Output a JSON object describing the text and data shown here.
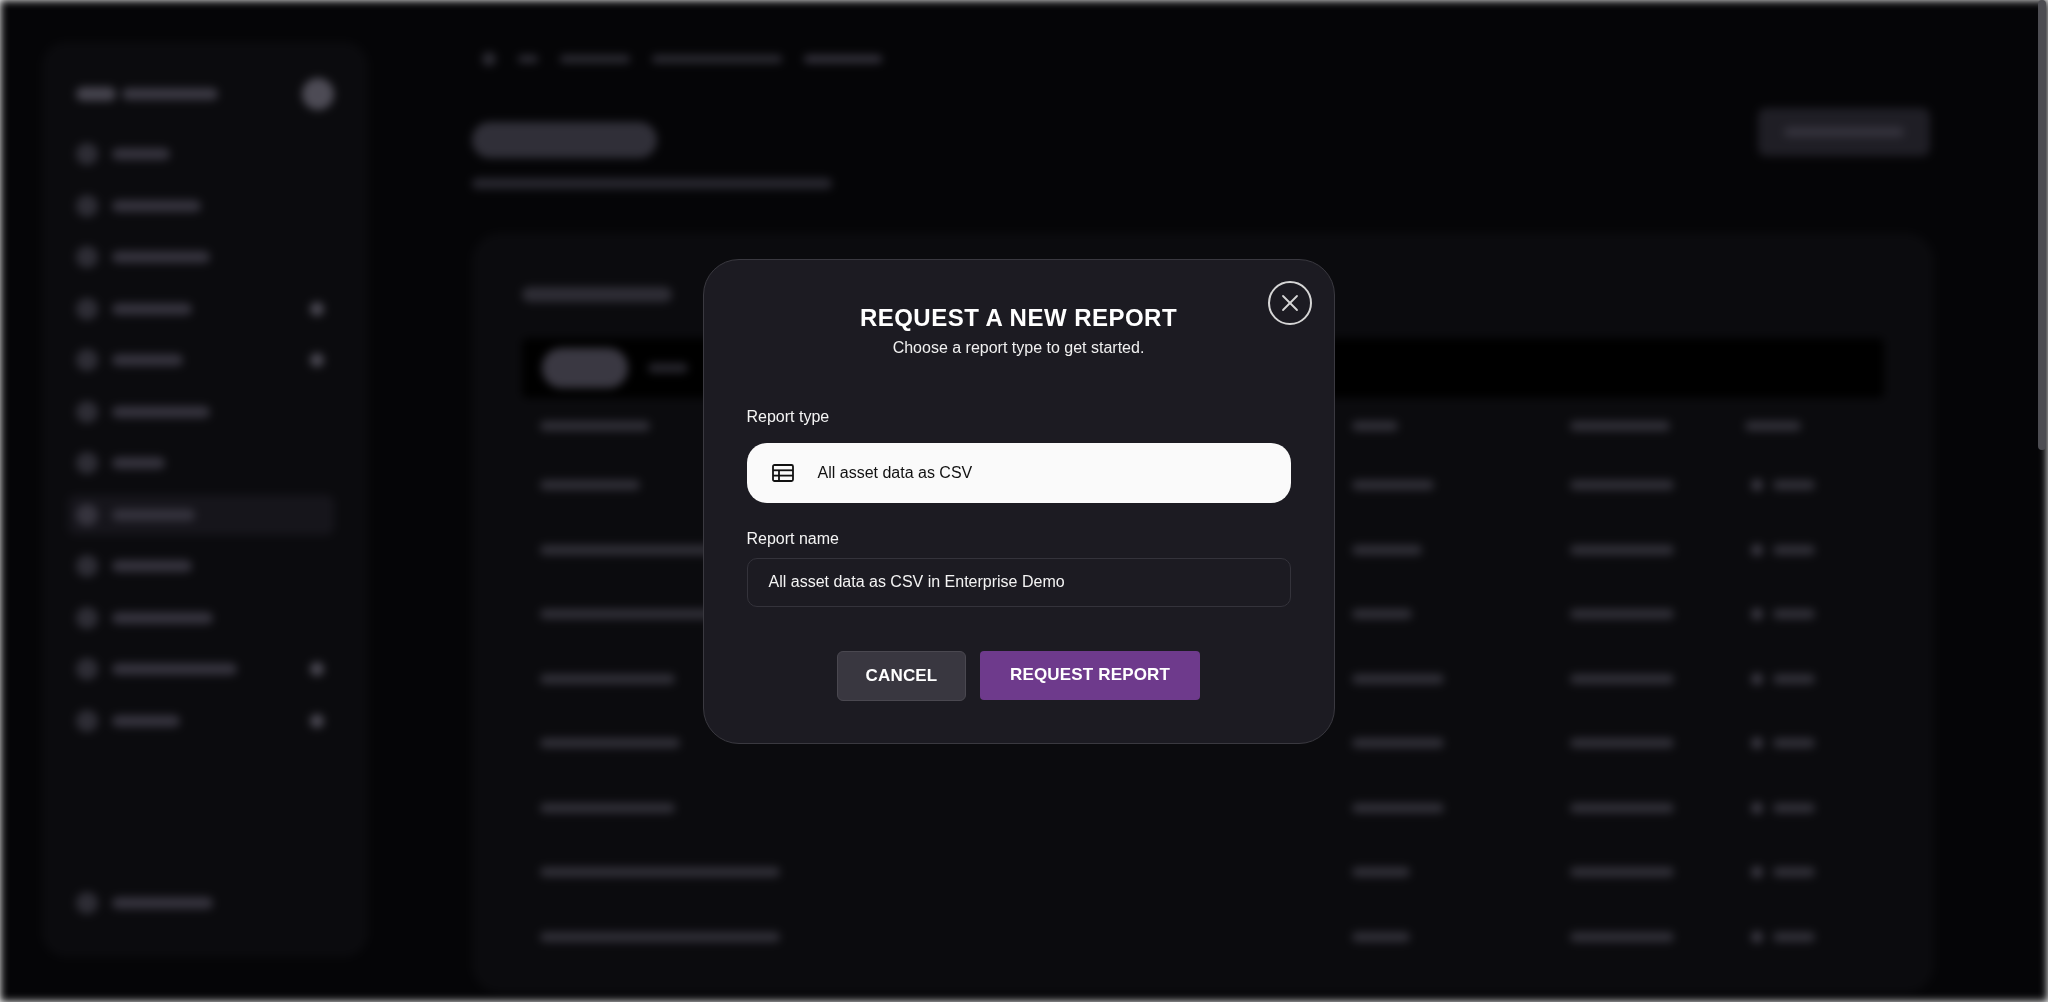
{
  "backdrop": {
    "blurred": true
  },
  "dialog": {
    "title": "REQUEST A NEW REPORT",
    "subtitle": "Choose a report type to get started.",
    "fields": [
      {
        "kind": "select",
        "label": "Report type",
        "value": "All asset data as CSV"
      },
      {
        "kind": "text",
        "label": "Report name",
        "value": "All asset data as CSV in Enterprise Demo"
      }
    ],
    "buttons": [
      {
        "kind": "secondary",
        "label": "CANCEL"
      },
      {
        "kind": "primary",
        "label": "REQUEST REPORT"
      }
    ]
  }
}
